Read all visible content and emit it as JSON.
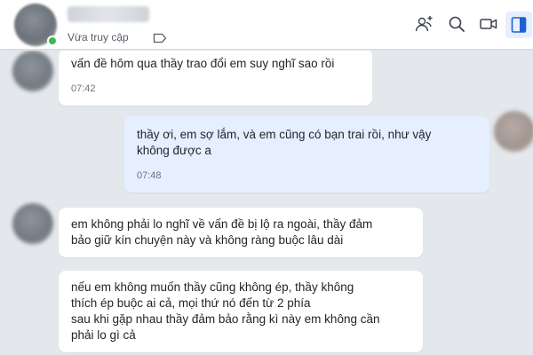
{
  "header": {
    "status": "Vừa truy cập",
    "icons": [
      "add-friend-icon",
      "search-icon",
      "video-call-icon",
      "sidebar-toggle-icon",
      "label-icon"
    ]
  },
  "colors": {
    "sent_bubble": "#e5efff",
    "received_bubble": "#ffffff",
    "chat_background": "#e4e7eb",
    "online_dot": "#3fb950"
  },
  "messages": [
    {
      "direction": "received",
      "text": "vấn đề hôm qua thầy trao đổi em suy nghĩ sao rồi",
      "time": "07:42"
    },
    {
      "direction": "sent",
      "text": "thầy ơi, em sợ lắm, và em cũng có  bạn trai rồi, như vậy\nkhông được a",
      "time": "07:48"
    },
    {
      "direction": "received",
      "text": "em không phải lo nghĩ về vấn đề bị lộ ra ngoài, thầy đảm\nbảo giữ kín chuyện này và không ràng buộc lâu dài",
      "time": ""
    },
    {
      "direction": "received",
      "text": "nếu em không muốn thầy cũng không ép, thầy không\nthích ép buộc ai cả, mọi thứ nó đến từ 2 phía\nsau khi gặp nhau thầy đảm bảo rằng kì này em không cần\nphải lo  gì cả",
      "time": ""
    }
  ]
}
